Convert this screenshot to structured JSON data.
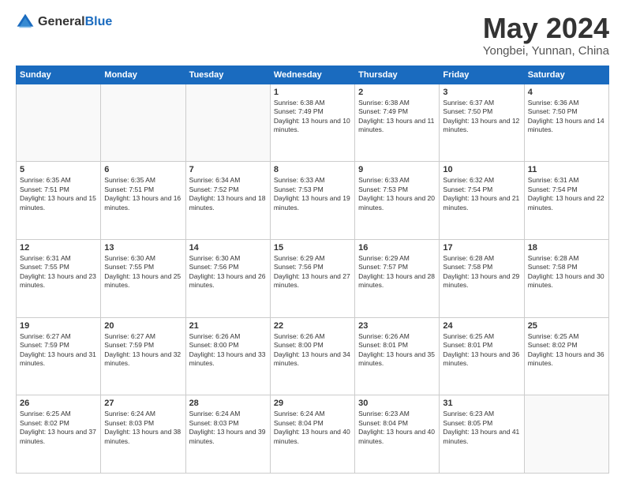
{
  "header": {
    "logo_general": "General",
    "logo_blue": "Blue",
    "month_title": "May 2024",
    "location": "Yongbei, Yunnan, China"
  },
  "weekdays": [
    "Sunday",
    "Monday",
    "Tuesday",
    "Wednesday",
    "Thursday",
    "Friday",
    "Saturday"
  ],
  "weeks": [
    [
      {
        "day": "",
        "sunrise": "",
        "sunset": "",
        "daylight": ""
      },
      {
        "day": "",
        "sunrise": "",
        "sunset": "",
        "daylight": ""
      },
      {
        "day": "",
        "sunrise": "",
        "sunset": "",
        "daylight": ""
      },
      {
        "day": "1",
        "sunrise": "Sunrise: 6:38 AM",
        "sunset": "Sunset: 7:49 PM",
        "daylight": "Daylight: 13 hours and 10 minutes."
      },
      {
        "day": "2",
        "sunrise": "Sunrise: 6:38 AM",
        "sunset": "Sunset: 7:49 PM",
        "daylight": "Daylight: 13 hours and 11 minutes."
      },
      {
        "day": "3",
        "sunrise": "Sunrise: 6:37 AM",
        "sunset": "Sunset: 7:50 PM",
        "daylight": "Daylight: 13 hours and 12 minutes."
      },
      {
        "day": "4",
        "sunrise": "Sunrise: 6:36 AM",
        "sunset": "Sunset: 7:50 PM",
        "daylight": "Daylight: 13 hours and 14 minutes."
      }
    ],
    [
      {
        "day": "5",
        "sunrise": "Sunrise: 6:35 AM",
        "sunset": "Sunset: 7:51 PM",
        "daylight": "Daylight: 13 hours and 15 minutes."
      },
      {
        "day": "6",
        "sunrise": "Sunrise: 6:35 AM",
        "sunset": "Sunset: 7:51 PM",
        "daylight": "Daylight: 13 hours and 16 minutes."
      },
      {
        "day": "7",
        "sunrise": "Sunrise: 6:34 AM",
        "sunset": "Sunset: 7:52 PM",
        "daylight": "Daylight: 13 hours and 18 minutes."
      },
      {
        "day": "8",
        "sunrise": "Sunrise: 6:33 AM",
        "sunset": "Sunset: 7:53 PM",
        "daylight": "Daylight: 13 hours and 19 minutes."
      },
      {
        "day": "9",
        "sunrise": "Sunrise: 6:33 AM",
        "sunset": "Sunset: 7:53 PM",
        "daylight": "Daylight: 13 hours and 20 minutes."
      },
      {
        "day": "10",
        "sunrise": "Sunrise: 6:32 AM",
        "sunset": "Sunset: 7:54 PM",
        "daylight": "Daylight: 13 hours and 21 minutes."
      },
      {
        "day": "11",
        "sunrise": "Sunrise: 6:31 AM",
        "sunset": "Sunset: 7:54 PM",
        "daylight": "Daylight: 13 hours and 22 minutes."
      }
    ],
    [
      {
        "day": "12",
        "sunrise": "Sunrise: 6:31 AM",
        "sunset": "Sunset: 7:55 PM",
        "daylight": "Daylight: 13 hours and 23 minutes."
      },
      {
        "day": "13",
        "sunrise": "Sunrise: 6:30 AM",
        "sunset": "Sunset: 7:55 PM",
        "daylight": "Daylight: 13 hours and 25 minutes."
      },
      {
        "day": "14",
        "sunrise": "Sunrise: 6:30 AM",
        "sunset": "Sunset: 7:56 PM",
        "daylight": "Daylight: 13 hours and 26 minutes."
      },
      {
        "day": "15",
        "sunrise": "Sunrise: 6:29 AM",
        "sunset": "Sunset: 7:56 PM",
        "daylight": "Daylight: 13 hours and 27 minutes."
      },
      {
        "day": "16",
        "sunrise": "Sunrise: 6:29 AM",
        "sunset": "Sunset: 7:57 PM",
        "daylight": "Daylight: 13 hours and 28 minutes."
      },
      {
        "day": "17",
        "sunrise": "Sunrise: 6:28 AM",
        "sunset": "Sunset: 7:58 PM",
        "daylight": "Daylight: 13 hours and 29 minutes."
      },
      {
        "day": "18",
        "sunrise": "Sunrise: 6:28 AM",
        "sunset": "Sunset: 7:58 PM",
        "daylight": "Daylight: 13 hours and 30 minutes."
      }
    ],
    [
      {
        "day": "19",
        "sunrise": "Sunrise: 6:27 AM",
        "sunset": "Sunset: 7:59 PM",
        "daylight": "Daylight: 13 hours and 31 minutes."
      },
      {
        "day": "20",
        "sunrise": "Sunrise: 6:27 AM",
        "sunset": "Sunset: 7:59 PM",
        "daylight": "Daylight: 13 hours and 32 minutes."
      },
      {
        "day": "21",
        "sunrise": "Sunrise: 6:26 AM",
        "sunset": "Sunset: 8:00 PM",
        "daylight": "Daylight: 13 hours and 33 minutes."
      },
      {
        "day": "22",
        "sunrise": "Sunrise: 6:26 AM",
        "sunset": "Sunset: 8:00 PM",
        "daylight": "Daylight: 13 hours and 34 minutes."
      },
      {
        "day": "23",
        "sunrise": "Sunrise: 6:26 AM",
        "sunset": "Sunset: 8:01 PM",
        "daylight": "Daylight: 13 hours and 35 minutes."
      },
      {
        "day": "24",
        "sunrise": "Sunrise: 6:25 AM",
        "sunset": "Sunset: 8:01 PM",
        "daylight": "Daylight: 13 hours and 36 minutes."
      },
      {
        "day": "25",
        "sunrise": "Sunrise: 6:25 AM",
        "sunset": "Sunset: 8:02 PM",
        "daylight": "Daylight: 13 hours and 36 minutes."
      }
    ],
    [
      {
        "day": "26",
        "sunrise": "Sunrise: 6:25 AM",
        "sunset": "Sunset: 8:02 PM",
        "daylight": "Daylight: 13 hours and 37 minutes."
      },
      {
        "day": "27",
        "sunrise": "Sunrise: 6:24 AM",
        "sunset": "Sunset: 8:03 PM",
        "daylight": "Daylight: 13 hours and 38 minutes."
      },
      {
        "day": "28",
        "sunrise": "Sunrise: 6:24 AM",
        "sunset": "Sunset: 8:03 PM",
        "daylight": "Daylight: 13 hours and 39 minutes."
      },
      {
        "day": "29",
        "sunrise": "Sunrise: 6:24 AM",
        "sunset": "Sunset: 8:04 PM",
        "daylight": "Daylight: 13 hours and 40 minutes."
      },
      {
        "day": "30",
        "sunrise": "Sunrise: 6:23 AM",
        "sunset": "Sunset: 8:04 PM",
        "daylight": "Daylight: 13 hours and 40 minutes."
      },
      {
        "day": "31",
        "sunrise": "Sunrise: 6:23 AM",
        "sunset": "Sunset: 8:05 PM",
        "daylight": "Daylight: 13 hours and 41 minutes."
      },
      {
        "day": "",
        "sunrise": "",
        "sunset": "",
        "daylight": ""
      }
    ]
  ]
}
